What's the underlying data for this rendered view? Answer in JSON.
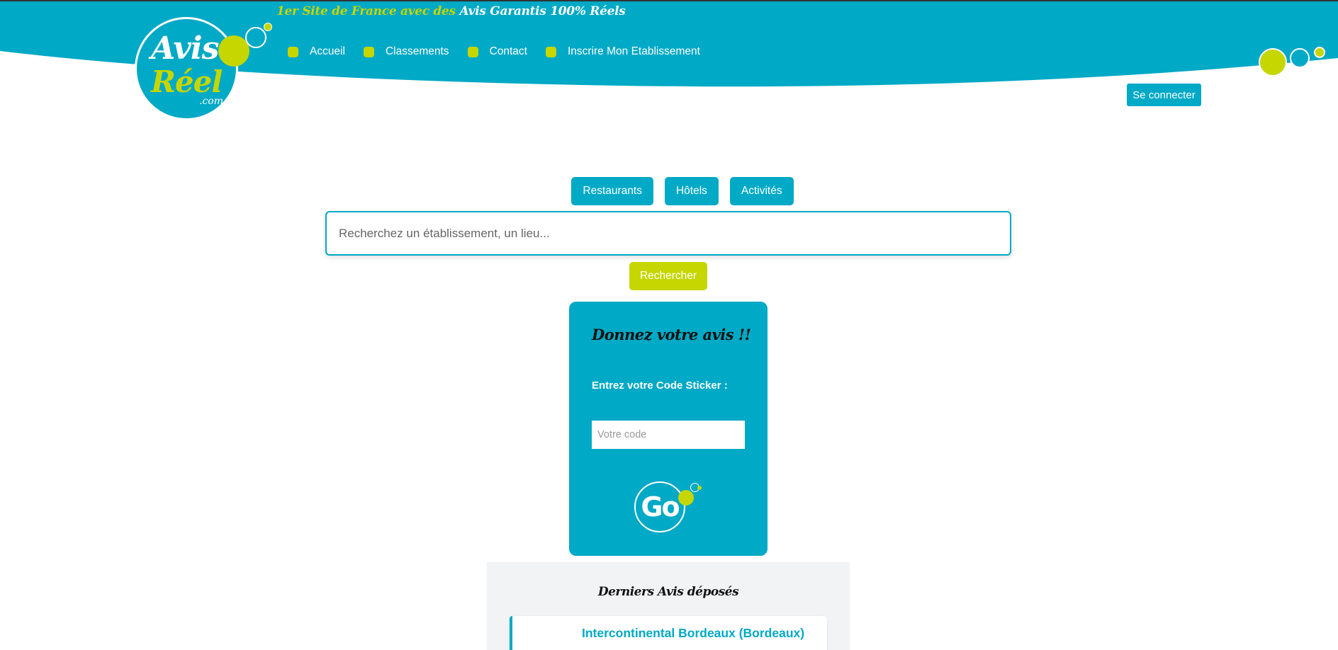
{
  "header": {
    "tagline_part1": "1er Site de France avec des",
    "tagline_part2": "Avis Garantis 100% Réels",
    "logo": {
      "line1": "Avis",
      "line2": "Réel",
      "line3": ".com"
    }
  },
  "nav": {
    "items": [
      {
        "label": "Accueil"
      },
      {
        "label": "Classements"
      },
      {
        "label": "Contact"
      },
      {
        "label": "Inscrire Mon Etablissement"
      }
    ]
  },
  "login": {
    "label": "Se connecter"
  },
  "categories": [
    {
      "label": "Restaurants"
    },
    {
      "label": "Hôtels"
    },
    {
      "label": "Activités"
    }
  ],
  "search": {
    "placeholder": "Recherchez un établissement, un lieu...",
    "button_label": "Rechercher"
  },
  "sticker": {
    "title": "Donnez votre avis !!",
    "label": "Entrez votre Code Sticker :",
    "input_placeholder": "Votre code",
    "go_label": "Go"
  },
  "reviews": {
    "title": "Derniers Avis déposés",
    "items": [
      {
        "name": "Intercontinental Bordeaux (Bordeaux)"
      }
    ]
  },
  "colors": {
    "brand_blue": "#00a9c5",
    "brand_green": "#c5d600",
    "background": "#ffffff",
    "panel_gray": "#f2f3f4"
  }
}
